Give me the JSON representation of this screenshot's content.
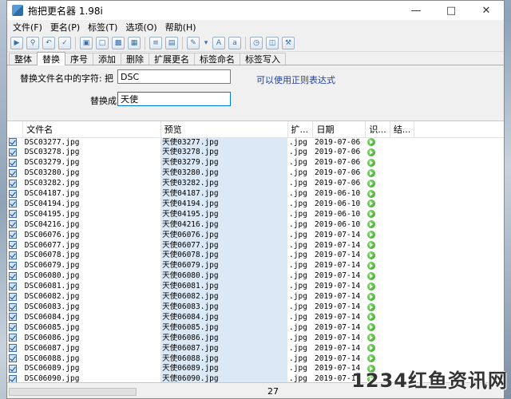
{
  "window": {
    "title": "拖把更名器 1.98i"
  },
  "menu": [
    "文件(F)",
    "更名(P)",
    "标签(T)",
    "选项(O)",
    "帮助(H)"
  ],
  "tabs": [
    "整体",
    "替换",
    "序号",
    "添加",
    "删除",
    "扩展更名",
    "标签命名",
    "标签写入"
  ],
  "active_tab": 1,
  "replace_panel": {
    "find_label": "替换文件名中的字符:",
    "find_prefix": "把",
    "find_value": "DSC",
    "hint": "可以使用正则表达式",
    "replace_label": "替换成",
    "replace_value": "天使"
  },
  "columns": [
    "文件名",
    "预览",
    "扩...",
    "日期",
    "识...",
    "结..."
  ],
  "rows": [
    {
      "name": "DSC03277.jpg",
      "preview": "天使03277.jpg",
      "ext": ".jpg",
      "date": "2019-07-06"
    },
    {
      "name": "DSC03278.jpg",
      "preview": "天使03278.jpg",
      "ext": ".jpg",
      "date": "2019-07-06"
    },
    {
      "name": "DSC03279.jpg",
      "preview": "天使03279.jpg",
      "ext": ".jpg",
      "date": "2019-07-06"
    },
    {
      "name": "DSC03280.jpg",
      "preview": "天使03280.jpg",
      "ext": ".jpg",
      "date": "2019-07-06"
    },
    {
      "name": "DSC03282.jpg",
      "preview": "天使03282.jpg",
      "ext": ".jpg",
      "date": "2019-07-06"
    },
    {
      "name": "DSC04187.jpg",
      "preview": "天使04187.jpg",
      "ext": ".jpg",
      "date": "2019-06-10"
    },
    {
      "name": "DSC04194.jpg",
      "preview": "天使04194.jpg",
      "ext": ".jpg",
      "date": "2019-06-10"
    },
    {
      "name": "DSC04195.jpg",
      "preview": "天使04195.jpg",
      "ext": ".jpg",
      "date": "2019-06-10"
    },
    {
      "name": "DSC04216.jpg",
      "preview": "天使04216.jpg",
      "ext": ".jpg",
      "date": "2019-06-10"
    },
    {
      "name": "DSC06076.jpg",
      "preview": "天使06076.jpg",
      "ext": ".jpg",
      "date": "2019-07-14"
    },
    {
      "name": "DSC06077.jpg",
      "preview": "天使06077.jpg",
      "ext": ".jpg",
      "date": "2019-07-14"
    },
    {
      "name": "DSC06078.jpg",
      "preview": "天使06078.jpg",
      "ext": ".jpg",
      "date": "2019-07-14"
    },
    {
      "name": "DSC06079.jpg",
      "preview": "天使06079.jpg",
      "ext": ".jpg",
      "date": "2019-07-14"
    },
    {
      "name": "DSC06080.jpg",
      "preview": "天使06080.jpg",
      "ext": ".jpg",
      "date": "2019-07-14"
    },
    {
      "name": "DSC06081.jpg",
      "preview": "天使06081.jpg",
      "ext": ".jpg",
      "date": "2019-07-14"
    },
    {
      "name": "DSC06082.jpg",
      "preview": "天使06082.jpg",
      "ext": ".jpg",
      "date": "2019-07-14"
    },
    {
      "name": "DSC06083.jpg",
      "preview": "天使06083.jpg",
      "ext": ".jpg",
      "date": "2019-07-14"
    },
    {
      "name": "DSC06084.jpg",
      "preview": "天使06084.jpg",
      "ext": ".jpg",
      "date": "2019-07-14"
    },
    {
      "name": "DSC06085.jpg",
      "preview": "天使06085.jpg",
      "ext": ".jpg",
      "date": "2019-07-14"
    },
    {
      "name": "DSC06086.jpg",
      "preview": "天使06086.jpg",
      "ext": ".jpg",
      "date": "2019-07-14"
    },
    {
      "name": "DSC06087.jpg",
      "preview": "天使06087.jpg",
      "ext": ".jpg",
      "date": "2019-07-14"
    },
    {
      "name": "DSC06088.jpg",
      "preview": "天使06088.jpg",
      "ext": ".jpg",
      "date": "2019-07-14"
    },
    {
      "name": "DSC06089.jpg",
      "preview": "天使06089.jpg",
      "ext": ".jpg",
      "date": "2019-07-14"
    },
    {
      "name": "DSC06090.jpg",
      "preview": "天使06090.jpg",
      "ext": ".jpg",
      "date": "2019-07-14"
    }
  ],
  "status": {
    "count": "27"
  },
  "watermark": "1234红鱼资讯网",
  "colors": {
    "preview_bg": "#dbe9f7",
    "hint": "#1e3fa0",
    "ok": "#2e9b1e"
  }
}
